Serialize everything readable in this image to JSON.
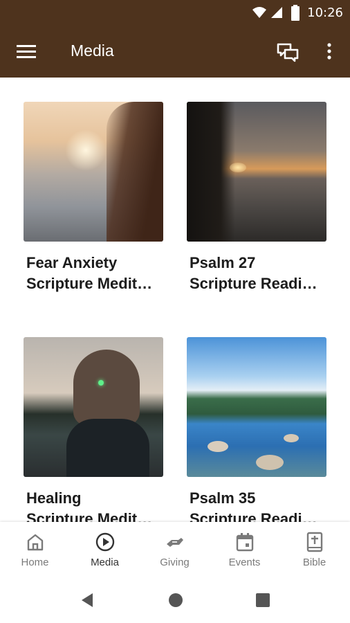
{
  "status_bar": {
    "time": "10:26"
  },
  "app_bar": {
    "title": "Media",
    "menu_icon": "hamburger-menu-icon",
    "chat_icon": "chat-bubbles-icon",
    "more_icon": "more-vert-icon"
  },
  "media_items": [
    {
      "line1": "Fear Anxiety",
      "line2": "Scripture Medit…"
    },
    {
      "line1": "Psalm 27",
      "line2": "Scripture Readi…"
    },
    {
      "line1": "Healing",
      "line2": "Scripture Medit…"
    },
    {
      "line1": "Psalm 35",
      "line2": "Scripture Readi…"
    }
  ],
  "bottom_nav": [
    {
      "label": "Home",
      "icon": "home-icon"
    },
    {
      "label": "Media",
      "icon": "play-circle-icon",
      "active": true
    },
    {
      "label": "Giving",
      "icon": "giving-hand-icon"
    },
    {
      "label": "Events",
      "icon": "calendar-icon"
    },
    {
      "label": "Bible",
      "icon": "bible-icon"
    }
  ],
  "colors": {
    "primary": "#4e331d",
    "nav_inactive": "#7a7a7a",
    "nav_active": "#333333"
  }
}
